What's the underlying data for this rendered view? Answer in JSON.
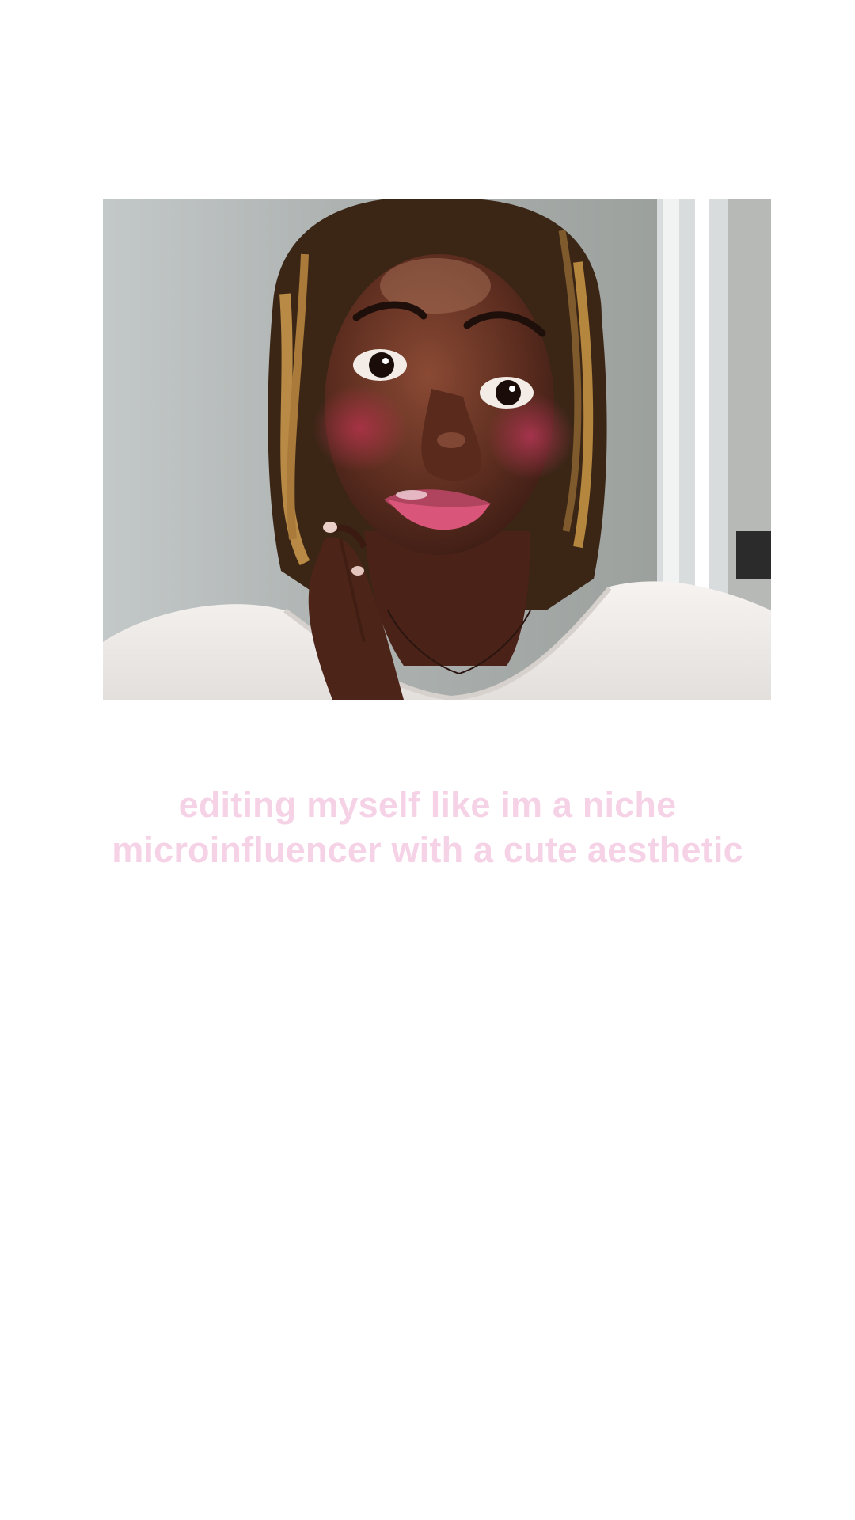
{
  "caption": {
    "text": "editing myself like im a niche microinfluencer with a cute aesthetic",
    "color": "#f6d2e6"
  },
  "video": {
    "subject": "selfie-video-frame"
  },
  "colors": {
    "background": "#ffffff",
    "caption_pink": "#f6d2e6",
    "wall_gray": "#a6aaa8",
    "top_white": "#f3efec"
  }
}
